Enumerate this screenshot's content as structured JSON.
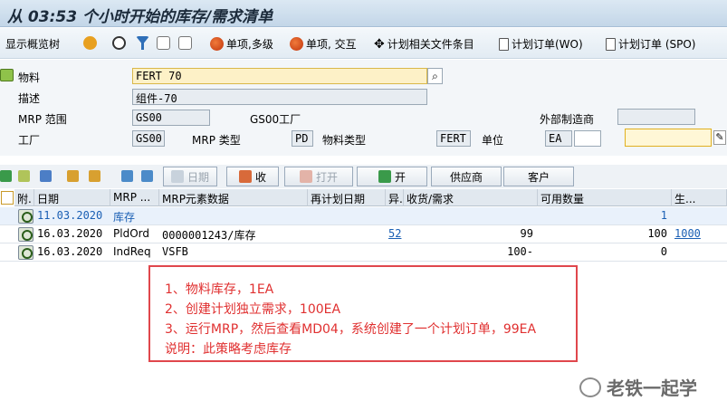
{
  "title": "从 03:53 个小时开始的库存/需求清单",
  "toolbar": {
    "items": [
      "显示概览树",
      "单项,多级",
      "单项, 交互",
      "计划相关文件条目",
      "计划订单(WO)",
      "计划订单 (SPO)"
    ]
  },
  "header": {
    "material_label": "物料",
    "material_value": "FERT 70",
    "desc_label": "描述",
    "desc_value": "组件-70",
    "mrp_area_label": "MRP 范围",
    "mrp_area_value": "GS00",
    "mrp_area_plant": "GS00工厂",
    "ext_proc_label": "外部制造商",
    "plant_label": "工厂",
    "plant_value": "GS00",
    "mrp_type_label": "MRP 类型",
    "mrp_type_value": "PD",
    "mat_type_label": "物料类型",
    "mat_type_value": "FERT",
    "unit_label": "单位",
    "unit_value": "EA"
  },
  "buttons": {
    "date": "日期",
    "receipt": "收",
    "open": "打开",
    "issue": "开",
    "vendor": "供应商",
    "customer": "客户"
  },
  "grid": {
    "headers": [
      "附.",
      "日期",
      "MRP ...",
      "MRP元素数据",
      "再计划日期",
      "异.",
      "收货/需求",
      "可用数量",
      "生..."
    ],
    "rows": [
      {
        "date": "11.03.2020",
        "mrp": "库存",
        "data": "",
        "resched": "",
        "exc": "",
        "qty": "",
        "avail": "1",
        "prod": ""
      },
      {
        "date": "16.03.2020",
        "mrp": "PldOrd",
        "data": "0000001243/库存",
        "resched": "",
        "exc": "52",
        "qty": "99",
        "avail": "100",
        "prod": "1000"
      },
      {
        "date": "16.03.2020",
        "mrp": "IndReq",
        "data": "VSFB",
        "resched": "",
        "exc": "",
        "qty": "100-",
        "avail": "0",
        "prod": ""
      }
    ]
  },
  "note": {
    "lines": [
      "1、物料库存，1EA",
      "2、创建计划独立需求，100EA",
      "3、运行MRP，然后查看MD04，系统创建了一个计划订单，99EA",
      "说明：此策略考虑库存"
    ]
  },
  "watermark": "老铁一起学"
}
